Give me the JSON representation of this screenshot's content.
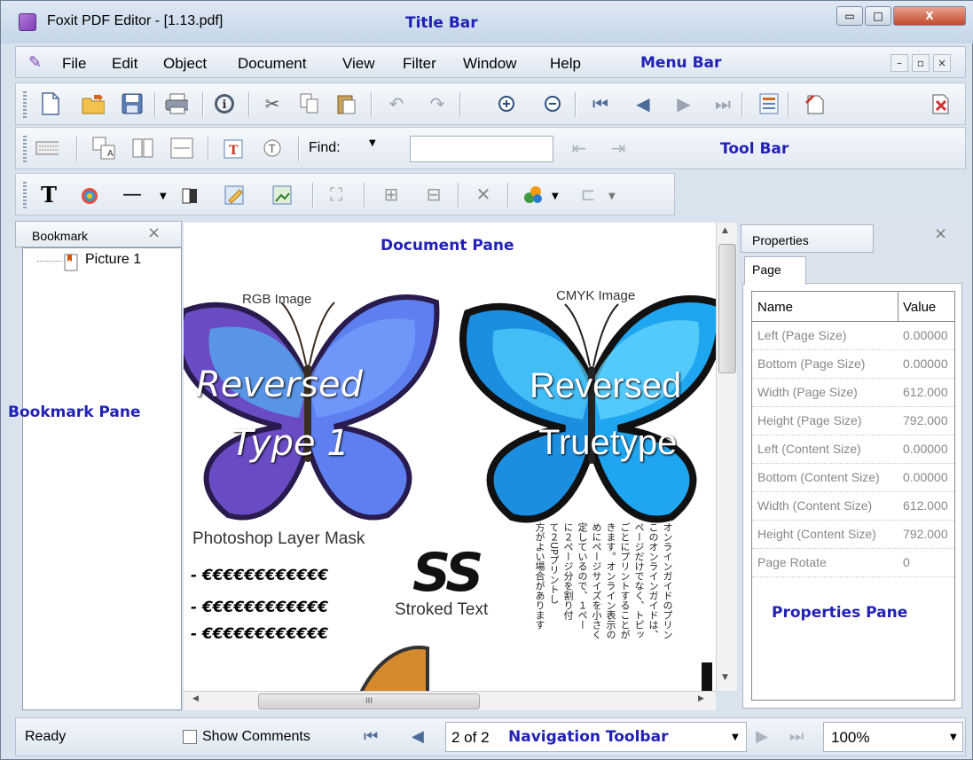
{
  "title_bar": {
    "text": "Foxit PDF Editor - [1.13.pdf]",
    "label": "Title Bar"
  },
  "window_controls": {
    "minimize": "▭",
    "maximize": "□",
    "close": "X"
  },
  "menu_bar": {
    "items": [
      "File",
      "Edit",
      "Object",
      "Document",
      "View",
      "Filter",
      "Window",
      "Help"
    ],
    "label": "Menu Bar",
    "mdi": {
      "minimize": "–",
      "restore": "▫",
      "close": "×"
    }
  },
  "toolbar": {
    "find_label": "Find:",
    "find_value": "",
    "label": "Tool Bar"
  },
  "bookmark_pane": {
    "tab": "Bookmark",
    "close": "×",
    "items": [
      "Picture 1"
    ],
    "label": "Bookmark Pane"
  },
  "document_pane": {
    "label": "Document Pane",
    "rgb_caption": "RGB Image",
    "cmyk_caption": "CMYK Image",
    "left_text_1": "Reversed",
    "left_text_2": "Type 1",
    "right_text_1": "Reversed",
    "right_text_2": "Truetype",
    "layer_mask": "Photoshop Layer Mask",
    "euro_line": "- €€€€€€€€€€€€",
    "ss": "SS",
    "stroked": "Stroked Text",
    "japanese_cols": [
      "オンラインガイドのプリン",
      "このオンラインガイドは、",
      "ページだけでなく、トピッ",
      "ごとにプリントすることが",
      "きます。オンライン表示の",
      "めにページサイズを小さく",
      "定しているので、１ペー",
      "に２ページ分を割り付",
      "て２UPプリントし",
      "方がよい場合があります"
    ],
    "hscroll_grip": "III"
  },
  "properties_pane": {
    "title": "Properties",
    "close": "×",
    "tab": "Page",
    "col_name": "Name",
    "col_value": "Value",
    "rows": [
      {
        "name": "Left (Page Size)",
        "value": "0.00000"
      },
      {
        "name": "Bottom (Page Size)",
        "value": "0.00000"
      },
      {
        "name": "Width (Page Size)",
        "value": "612.000"
      },
      {
        "name": "Height (Page Size)",
        "value": "792.000"
      },
      {
        "name": "Left (Content Size)",
        "value": "0.00000"
      },
      {
        "name": "Bottom (Content Size)",
        "value": "0.00000"
      },
      {
        "name": "Width (Content Size)",
        "value": "612.000"
      },
      {
        "name": "Height (Content Size)",
        "value": "792.000"
      },
      {
        "name": "Page Rotate",
        "value": "0"
      }
    ],
    "label": "Properties Pane"
  },
  "status_bar": {
    "ready": "Ready",
    "show_comments": "Show Comments",
    "page": "2 of 2",
    "nav_label": "Navigation Toolbar",
    "zoom": "100%"
  }
}
